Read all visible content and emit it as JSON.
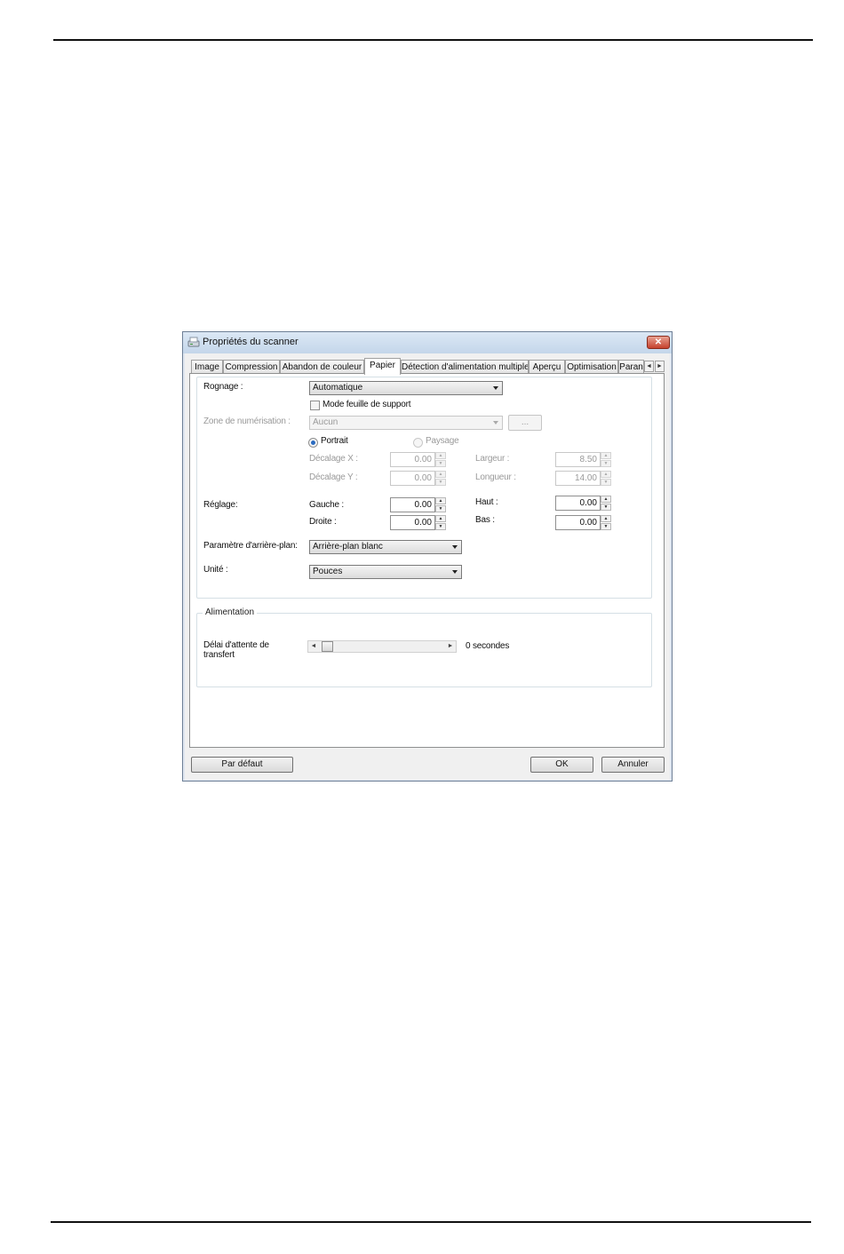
{
  "window": {
    "title": "Propriétés du scanner",
    "close_glyph": "✕"
  },
  "tabs": [
    {
      "label": "Image",
      "active": false
    },
    {
      "label": "Compression",
      "active": false
    },
    {
      "label": "Abandon de couleur",
      "active": false
    },
    {
      "label": "Papier",
      "active": true
    },
    {
      "label": "Détection d'alimentation multiple",
      "active": false
    },
    {
      "label": "Aperçu",
      "active": false
    },
    {
      "label": "Optimisation",
      "active": false
    },
    {
      "label": "Paran",
      "active": false
    }
  ],
  "tab_scroll": {
    "left": "◄",
    "right": "►"
  },
  "paper": {
    "cropping": {
      "label": "Rognage :",
      "value": "Automatique"
    },
    "carrier_mode": {
      "label": "Mode feuille de support",
      "checked": false
    },
    "scan_area": {
      "label": "Zone de numérisation :",
      "value": "Aucun",
      "browse_label": "..."
    },
    "orientation": {
      "portrait": "Portrait",
      "landscape": "Paysage",
      "selected": "Portrait"
    },
    "offset_x": {
      "label": "Décalage X :",
      "value": "0.00"
    },
    "offset_y": {
      "label": "Décalage Y :",
      "value": "0.00"
    },
    "width": {
      "label": "Largeur :",
      "value": "8.50"
    },
    "length": {
      "label": "Longueur :",
      "value": "14.00"
    },
    "adjust": {
      "label": "Réglage:",
      "left": {
        "label": "Gauche :",
        "value": "0.00"
      },
      "right": {
        "label": "Droite :",
        "value": "0.00"
      },
      "top": {
        "label": "Haut :",
        "value": "0.00"
      },
      "bottom": {
        "label": "Bas :",
        "value": "0.00"
      }
    },
    "background": {
      "label": "Paramètre d'arrière-plan:",
      "value": "Arrière-plan blanc"
    },
    "unit": {
      "label": "Unité :",
      "value": "Pouces"
    }
  },
  "feeding": {
    "group_title": "Alimentation",
    "transfer_delay_label_1": "Délai d'attente de",
    "transfer_delay_label_2": "transfert",
    "transfer_delay_value": "0 secondes",
    "slider_value": 0
  },
  "buttons": {
    "default": "Par défaut",
    "ok": "OK",
    "cancel": "Annuler"
  },
  "spin_glyphs": {
    "up": "▲",
    "down": "▼"
  },
  "slider_glyphs": {
    "left": "◄",
    "right": "►"
  }
}
